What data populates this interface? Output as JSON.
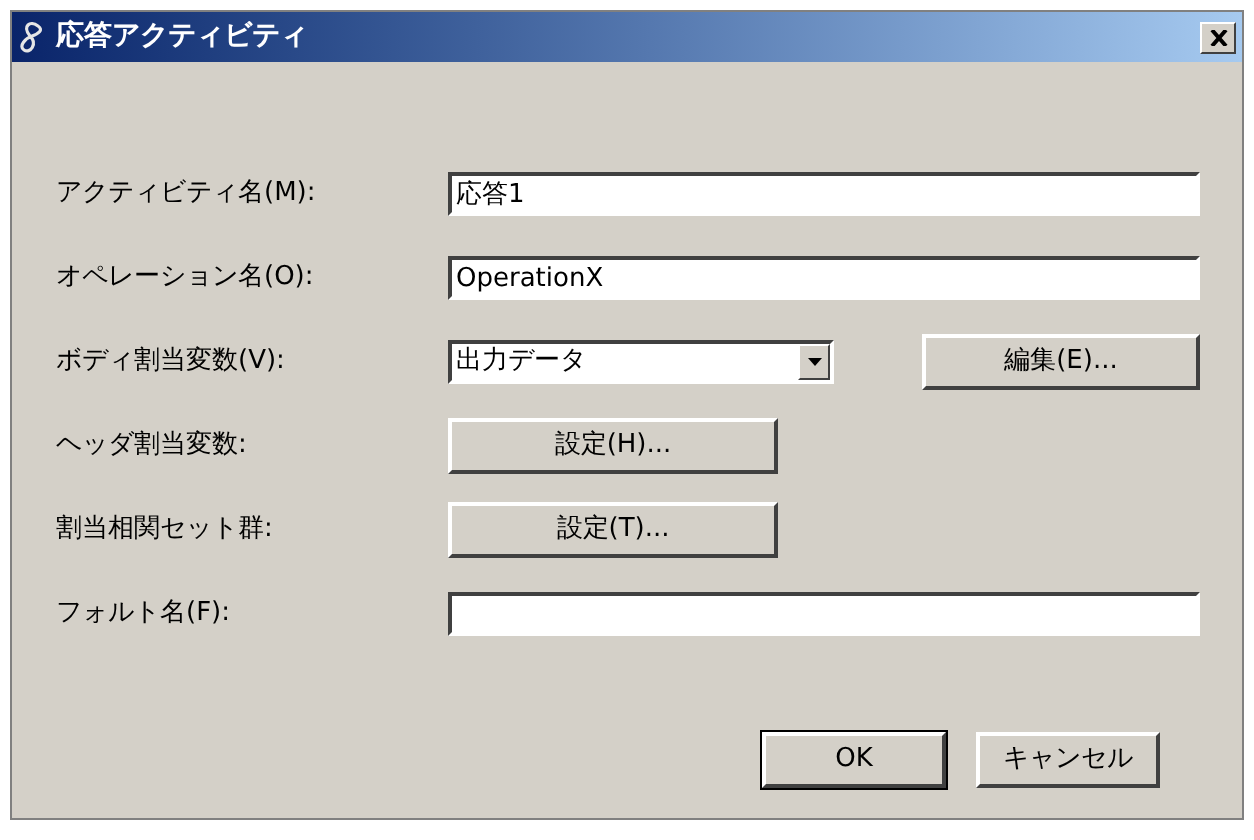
{
  "window": {
    "title": "応答アクティビティ"
  },
  "rows": [
    {
      "kind": "text",
      "label": "アクティビティ名(M):",
      "value": "応答1"
    },
    {
      "kind": "text",
      "label": "オペレーション名(O):",
      "value": "OperationX"
    },
    {
      "kind": "combo",
      "label": "ボディ割当変数(V):",
      "value": "出力データ",
      "button": "編集(E)..."
    },
    {
      "kind": "button",
      "label": "ヘッダ割当変数:",
      "button": "設定(H)..."
    },
    {
      "kind": "button",
      "label": "割当相関セット群:",
      "button": "設定(T)..."
    },
    {
      "kind": "text",
      "label": "フォルト名(F):"
    }
  ],
  "buttons": [
    {
      "label": "OK",
      "default": true
    },
    {
      "label": "キャンセル",
      "default": false
    }
  ]
}
